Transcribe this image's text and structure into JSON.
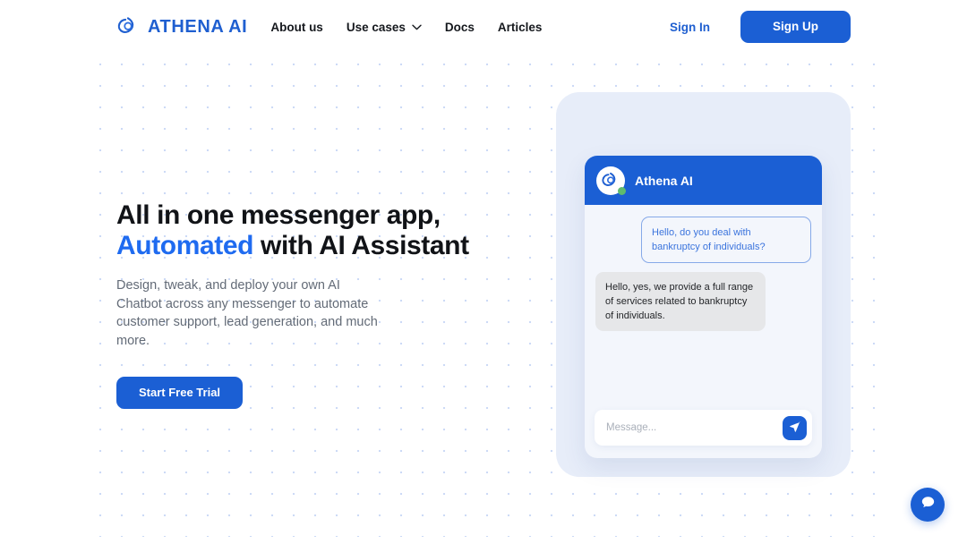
{
  "brand": {
    "name": "ATHENA AI",
    "logo_icon": "triquetra-logo-icon",
    "accent_color": "#1b5fd4"
  },
  "header": {
    "nav": [
      {
        "label": "About us",
        "has_dropdown": false
      },
      {
        "label": "Use cases",
        "has_dropdown": true,
        "icon": "chevron-down-icon"
      },
      {
        "label": "Docs",
        "has_dropdown": false
      },
      {
        "label": "Articles",
        "has_dropdown": false
      }
    ],
    "sign_in_label": "Sign In",
    "sign_up_label": "Sign Up"
  },
  "hero": {
    "headline_line1": "All in one messenger app,",
    "headline_accent": "Automated",
    "headline_line2_rest": " with AI Assistant",
    "subtitle": "Design, tweak, and deploy your own AI Chatbot across any messenger to automate customer support, lead generation, and much more.",
    "cta_label": "Start Free Trial"
  },
  "chat_widget": {
    "title": "Athena AI",
    "avatar_icon": "triquetra-logo-icon",
    "status_color": "#5fbb6e",
    "messages": [
      {
        "from": "user",
        "text": "Hello, do you deal with bankruptcy of individuals?"
      },
      {
        "from": "bot",
        "text": "Hello, yes, we provide a full range of services related to bankruptcy of individuals."
      }
    ],
    "composer": {
      "value": "",
      "placeholder": "Message...",
      "send_icon": "paper-plane-icon"
    }
  },
  "launcher": {
    "icon": "chat-bubble-icon"
  }
}
